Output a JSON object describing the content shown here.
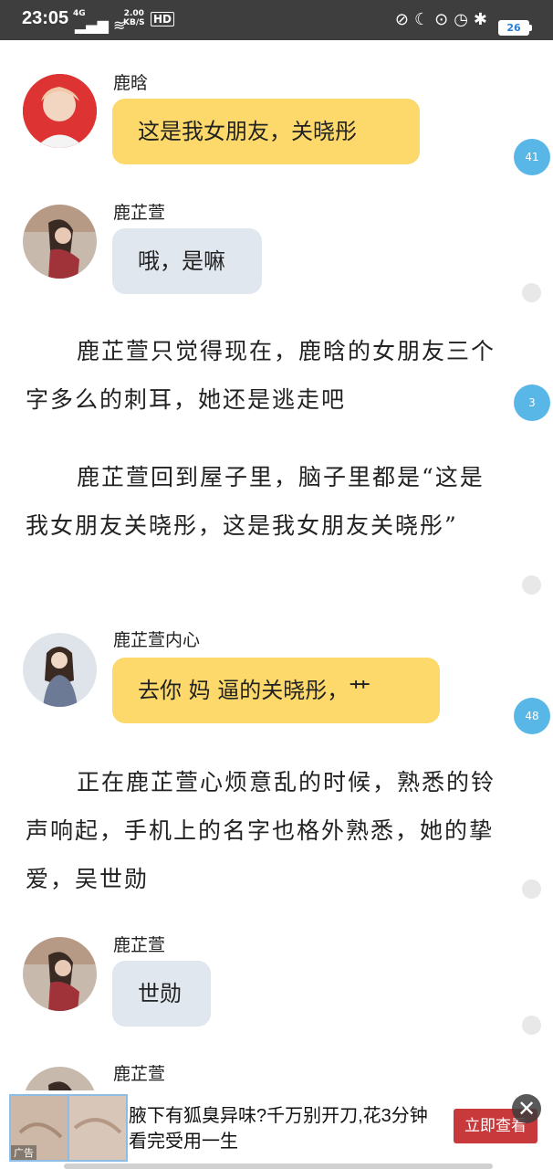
{
  "status_bar": {
    "time": "23:05",
    "network": "4G",
    "speed_value": "2.00",
    "speed_unit": "KB/S",
    "hd": "HD",
    "battery": "26"
  },
  "messages": [
    {
      "name": "鹿晗",
      "text": "这是我女朋友，关晓彤",
      "count": "41"
    },
    {
      "name": "鹿芷萱",
      "text": "哦，是嘛"
    },
    {
      "name": "鹿芷萱内心",
      "text": "去你 妈 逼的关晓彤，艹",
      "count": "48"
    },
    {
      "name": "鹿芷萱",
      "text": "世勋"
    },
    {
      "name": "鹿芷萱"
    }
  ],
  "paragraphs": [
    {
      "text": "鹿芷萱只觉得现在，鹿晗的女朋友三个字多么的刺耳，她还是逃走吧",
      "count": "3"
    },
    {
      "text": "鹿芷萱回到屋子里，脑子里都是“这是我女朋友关晓彤，这是我女朋友关晓彤”"
    },
    {
      "text": "正在鹿芷萱心烦意乱的时候，熟悉的铃声响起，手机上的名字也格外熟悉，她的挚爱，吴世勋"
    }
  ],
  "ad": {
    "label": "广告",
    "text": "腋下有狐臭异味?千万别开刀,花3分钟看完受用一生",
    "button": "立即查看"
  },
  "colors": {
    "yellow_bubble": "#fcd96a",
    "gray_bubble": "#e1e7ee",
    "count_badge": "#59b7e8",
    "ad_button": "#c8393b"
  }
}
